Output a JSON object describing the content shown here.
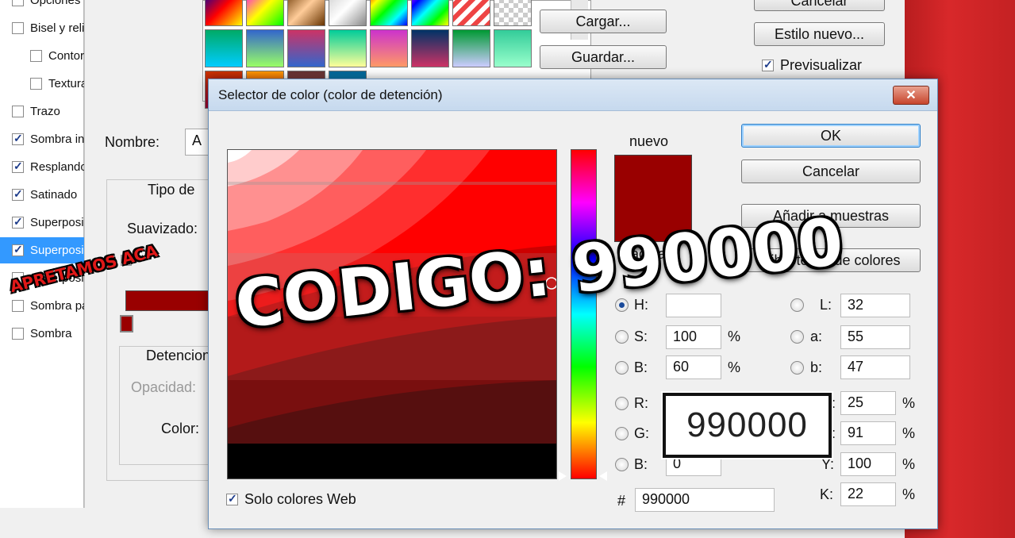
{
  "layer_style": {
    "style_items": [
      {
        "label": "Opciones de",
        "checked": false
      },
      {
        "label": "Bisel y relieve",
        "checked": false
      },
      {
        "label": "Contorno",
        "checked": false,
        "indent": true
      },
      {
        "label": "Textura",
        "checked": false,
        "indent": true
      },
      {
        "label": "Trazo",
        "checked": false
      },
      {
        "label": "Sombra interior",
        "checked": true
      },
      {
        "label": "Resplandor",
        "checked": true
      },
      {
        "label": "Satinado",
        "checked": true
      },
      {
        "label": "Superposición",
        "checked": true
      },
      {
        "label": "Superposición",
        "checked": true,
        "selected": true
      },
      {
        "label": "Superposición",
        "checked": false
      },
      {
        "label": "Sombra paralela",
        "checked": false
      },
      {
        "label": "Sombra",
        "checked": false
      }
    ],
    "nombre_label": "Nombre:",
    "nombre_value": "A",
    "tipo_label": "Tipo de",
    "suavizado_label": "Suavizado:",
    "detencion_label": "Detencion",
    "opacidad_label": "Opacidad:",
    "color_label": "Color:",
    "buttons": {
      "cargar": "Cargar...",
      "guardar": "Guardar...",
      "cancelar": "Cancelar",
      "estilo_nuevo": "Estilo nuevo..."
    },
    "previsualizar_label": "Previsualizar",
    "previsualizar_checked": true,
    "stop_color": "#990000"
  },
  "color_picker": {
    "title": "Selector de color (color de detención)",
    "close_label": "✕",
    "nuevo_label": "nuevo",
    "actual_label": "actual",
    "new_color": "#990000",
    "current_color": "#990000",
    "buttons": {
      "ok": "OK",
      "cancelar": "Cancelar",
      "anadir": "Añadir a muestras",
      "bibliotecas": "Bibliotecas de colores"
    },
    "hsb": [
      {
        "label": "H:",
        "value": "",
        "unit": "",
        "selected": true
      },
      {
        "label": "S:",
        "value": "100",
        "unit": "%",
        "selected": false
      },
      {
        "label": "B:",
        "value": "60",
        "unit": "%",
        "selected": false
      }
    ],
    "rgb": [
      {
        "label": "R:",
        "value": "",
        "selected": false
      },
      {
        "label": "G:",
        "value": "",
        "selected": false
      },
      {
        "label": "B:",
        "value": "0",
        "selected": false
      }
    ],
    "lab": [
      {
        "label": "L:",
        "value": "32"
      },
      {
        "label": "a:",
        "value": "55"
      },
      {
        "label": "b:",
        "value": "47"
      }
    ],
    "cmyk": [
      {
        "label": "C:",
        "value": "25",
        "unit": "%"
      },
      {
        "label": "M:",
        "value": "91",
        "unit": "%"
      },
      {
        "label": "Y:",
        "value": "100",
        "unit": "%"
      },
      {
        "label": "K:",
        "value": "22",
        "unit": "%"
      }
    ],
    "hex_label": "#",
    "hex_value": "990000",
    "web_only_label": "Solo colores Web",
    "web_only_checked": true
  },
  "overlay": {
    "codigo_text": "CODIGO: 990000",
    "zoom_text": "990000",
    "apretamos_text": "APRETAMOS ACA"
  }
}
